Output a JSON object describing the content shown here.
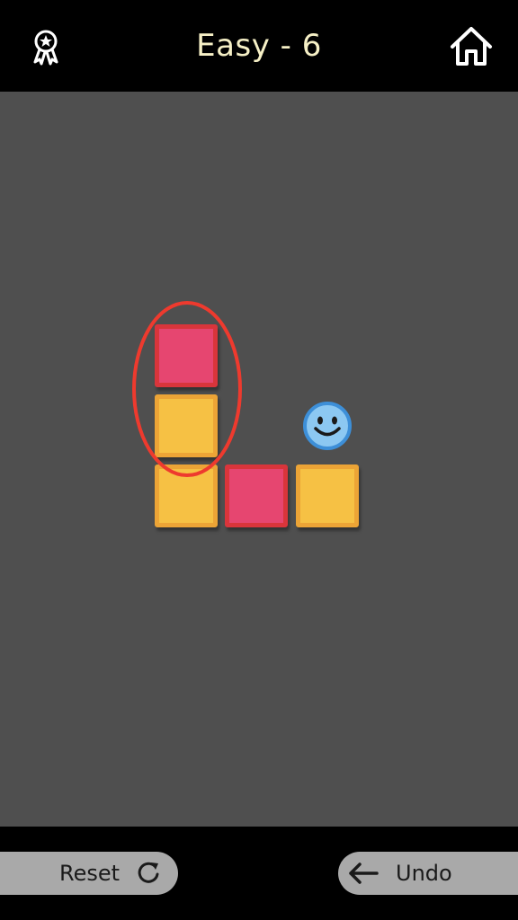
{
  "header": {
    "title": "Easy - 6",
    "award_icon": "ribbon-award-icon",
    "home_icon": "home-icon"
  },
  "board": {
    "background": "#4F4F4F",
    "blocks": [
      {
        "color": "red",
        "col": 0,
        "row": 0
      },
      {
        "color": "yellow",
        "col": 0,
        "row": 1
      },
      {
        "color": "yellow",
        "col": 0,
        "row": 2
      },
      {
        "color": "red",
        "col": 1,
        "row": 2
      },
      {
        "color": "yellow",
        "col": 2,
        "row": 2
      }
    ],
    "highlight": {
      "color": "#EE3A2E",
      "col": 0,
      "rows": [
        0,
        1
      ]
    },
    "player": {
      "icon": "smiley-face-icon",
      "col": 2,
      "row": 1
    }
  },
  "colors": {
    "red_fill": "#E64670",
    "red_border": "#D9353B",
    "yellow_fill": "#F6C144",
    "yellow_border": "#ECA436",
    "title_text": "#F6F0C6",
    "player_fill": "#8CC8F2",
    "player_ring": "#3D8FD8"
  },
  "footer": {
    "reset_label": "Reset",
    "reset_icon": "refresh-icon",
    "undo_label": "Undo",
    "undo_icon": "arrow-left-icon"
  }
}
